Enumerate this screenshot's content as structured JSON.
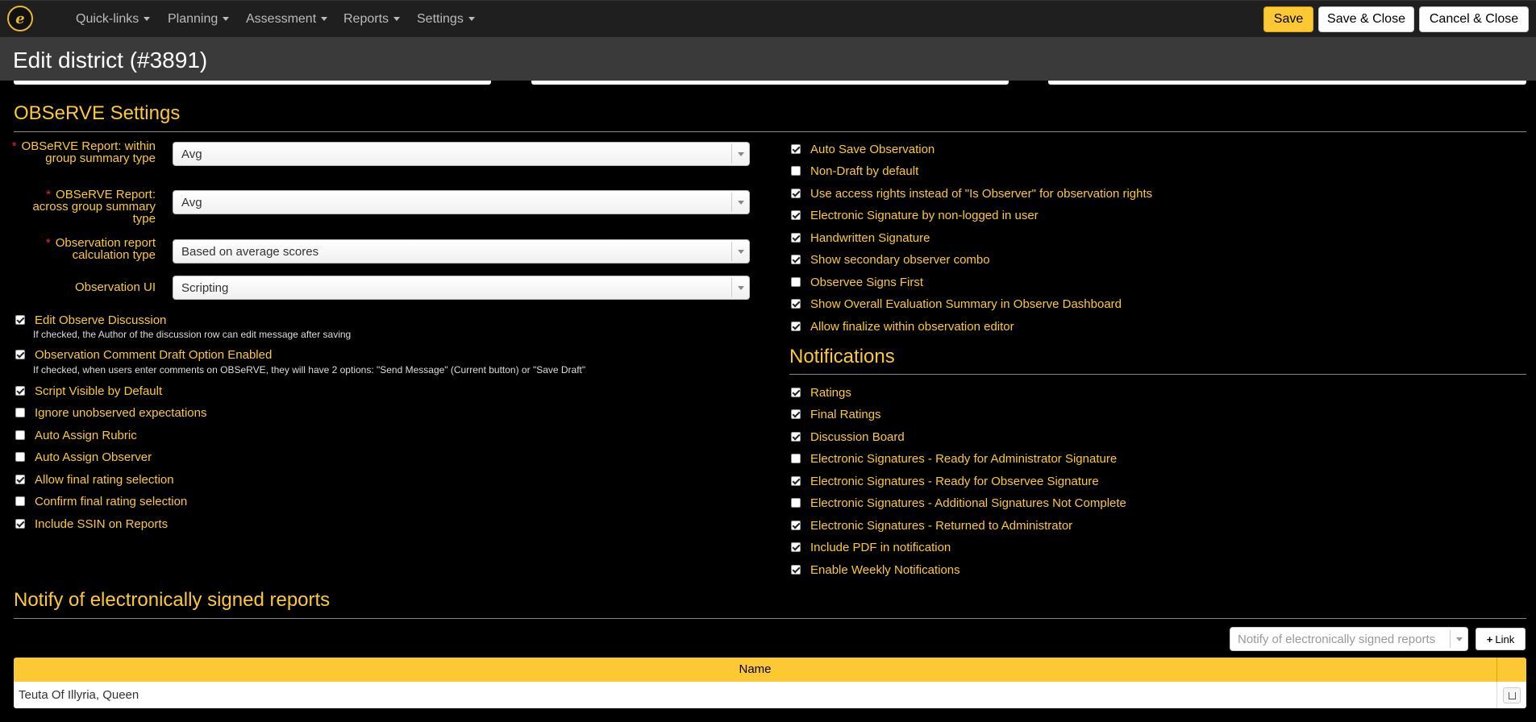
{
  "nav": {
    "logo_letter": "e",
    "items": [
      "Quick-links",
      "Planning",
      "Assessment",
      "Reports",
      "Settings"
    ],
    "save": "Save",
    "save_close": "Save & Close",
    "cancel_close": "Cancel & Close"
  },
  "page": {
    "title": "Edit district (#3891)"
  },
  "observe_settings": {
    "title": "OBSeRVE Settings",
    "selects": [
      {
        "label": "OBSeRVE Report: within group summary type",
        "value": "Avg",
        "required": true
      },
      {
        "label": "OBSeRVE Report: across group summary type",
        "value": "Avg",
        "required": true
      },
      {
        "label": "Observation report calculation type",
        "value": "Based on average scores",
        "required": true
      },
      {
        "label": "Observation UI",
        "value": "Scripting",
        "required": false
      }
    ],
    "left_checks": [
      {
        "label": "Edit Observe Discussion",
        "checked": true,
        "help": "If checked, the Author of the discussion row can edit message after saving"
      },
      {
        "label": "Observation Comment Draft Option Enabled",
        "checked": true,
        "help": "If checked, when users enter comments on OBSeRVE, they will have 2 options: \"Send Message\" (Current button) or \"Save Draft\""
      },
      {
        "label": "Script Visible by Default",
        "checked": true
      },
      {
        "label": "Ignore unobserved expectations",
        "checked": false
      },
      {
        "label": "Auto Assign Rubric",
        "checked": false
      },
      {
        "label": "Auto Assign Observer",
        "checked": false
      },
      {
        "label": "Allow final rating selection",
        "checked": true
      },
      {
        "label": "Confirm final rating selection",
        "checked": false
      },
      {
        "label": "Include SSIN on Reports",
        "checked": true
      }
    ],
    "right_checks": [
      {
        "label": "Auto Save Observation",
        "checked": true
      },
      {
        "label": "Non-Draft by default",
        "checked": false
      },
      {
        "label": "Use access rights instead of \"Is Observer\" for observation rights",
        "checked": true
      },
      {
        "label": "Electronic Signature by non-logged in user",
        "checked": true
      },
      {
        "label": "Handwritten Signature",
        "checked": true
      },
      {
        "label": "Show secondary observer combo",
        "checked": true
      },
      {
        "label": "Observee Signs First",
        "checked": false
      },
      {
        "label": "Show Overall Evaluation Summary in Observe Dashboard",
        "checked": true
      },
      {
        "label": "Allow finalize within observation editor",
        "checked": true
      }
    ]
  },
  "notifications": {
    "title": "Notifications",
    "checks": [
      {
        "label": "Ratings",
        "checked": true
      },
      {
        "label": "Final Ratings",
        "checked": true
      },
      {
        "label": "Discussion Board",
        "checked": true
      },
      {
        "label": "Electronic Signatures - Ready for Administrator Signature",
        "checked": false
      },
      {
        "label": "Electronic Signatures - Ready for Observee Signature",
        "checked": true
      },
      {
        "label": "Electronic Signatures - Additional Signatures Not Complete",
        "checked": false
      },
      {
        "label": "Electronic Signatures - Returned to Administrator",
        "checked": true
      },
      {
        "label": "Include PDF in notification",
        "checked": true
      },
      {
        "label": "Enable Weekly Notifications",
        "checked": true
      }
    ]
  },
  "notify_signed": {
    "title": "Notify of electronically signed reports",
    "select_placeholder": "Notify of electronically signed reports",
    "link_button": "Link",
    "table_header": "Name",
    "rows": [
      {
        "name": "Teuta Of Illyria, Queen"
      }
    ]
  }
}
